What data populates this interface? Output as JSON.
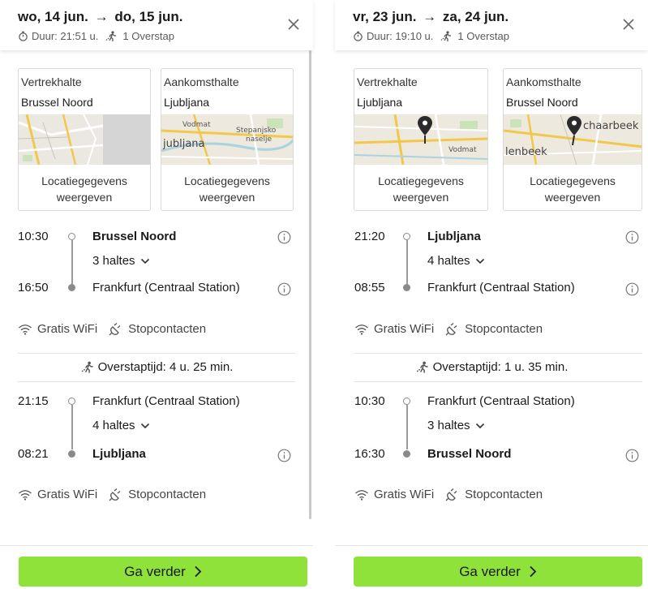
{
  "colors": {
    "accent": "#8ee23a",
    "timeline": "#8a8a8a",
    "pin": "#2b2b2b"
  },
  "left": {
    "date_from": "wo, 14 jun.",
    "date_to": "do, 15 jun.",
    "arrow": "→",
    "duration": "Duur: 21:51 u.",
    "transfers": "1 Overstap",
    "departure": {
      "label": "Vertrekhalte",
      "value": "Brussel Noord",
      "link": "Locatiegegevens weergeven"
    },
    "arrival": {
      "label": "Aankomsthalte",
      "value": "Ljubljana",
      "link": "Locatiegegevens weergeven",
      "map_text_1": "Vodmat",
      "map_text_2": "Stepanjsko",
      "map_text_3": "naselje",
      "map_text_4": "jubljana"
    },
    "leg1": {
      "dep_time": "10:30",
      "dep_stop": "Brussel Noord",
      "stops": "3 haltes",
      "arr_time": "16:50",
      "arr_stop": "Frankfurt (Centraal Station)"
    },
    "amenities1": {
      "wifi": "Gratis WiFi",
      "power": "Stopcontacten"
    },
    "transfer": "Overstaptijd: 4 u. 25 min.",
    "leg2": {
      "dep_time": "21:15",
      "dep_stop": "Frankfurt (Centraal Station)",
      "stops": "4 haltes",
      "arr_time": "08:21",
      "arr_stop": "Ljubljana"
    },
    "amenities2": {
      "wifi": "Gratis WiFi",
      "power": "Stopcontacten"
    },
    "cta": "Ga verder"
  },
  "right": {
    "date_from": "vr, 23 jun.",
    "date_to": "za, 24 jun.",
    "arrow": "→",
    "duration": "Duur: 19:10 u.",
    "transfers": "1 Overstap",
    "departure": {
      "label": "Vertrekhalte",
      "value": "Ljubljana",
      "link": "Locatiegegevens weergeven",
      "map_text_1": "Vodmat"
    },
    "arrival": {
      "label": "Aankomsthalte",
      "value": "Brussel Noord",
      "link": "Locatiegegevens weergeven",
      "map_text_1": "chaarbeek",
      "map_text_2": "lenbeek"
    },
    "leg1": {
      "dep_time": "21:20",
      "dep_stop": "Ljubljana",
      "stops": "4 haltes",
      "arr_time": "08:55",
      "arr_stop": "Frankfurt (Centraal Station)"
    },
    "amenities1": {
      "wifi": "Gratis WiFi",
      "power": "Stopcontacten"
    },
    "transfer": "Overstaptijd: 1 u. 35 min.",
    "leg2": {
      "dep_time": "10:30",
      "dep_stop": "Frankfurt (Centraal Station)",
      "stops": "3 haltes",
      "arr_time": "16:30",
      "arr_stop": "Brussel Noord"
    },
    "amenities2": {
      "wifi": "Gratis WiFi",
      "power": "Stopcontacten"
    },
    "cta": "Ga verder"
  }
}
